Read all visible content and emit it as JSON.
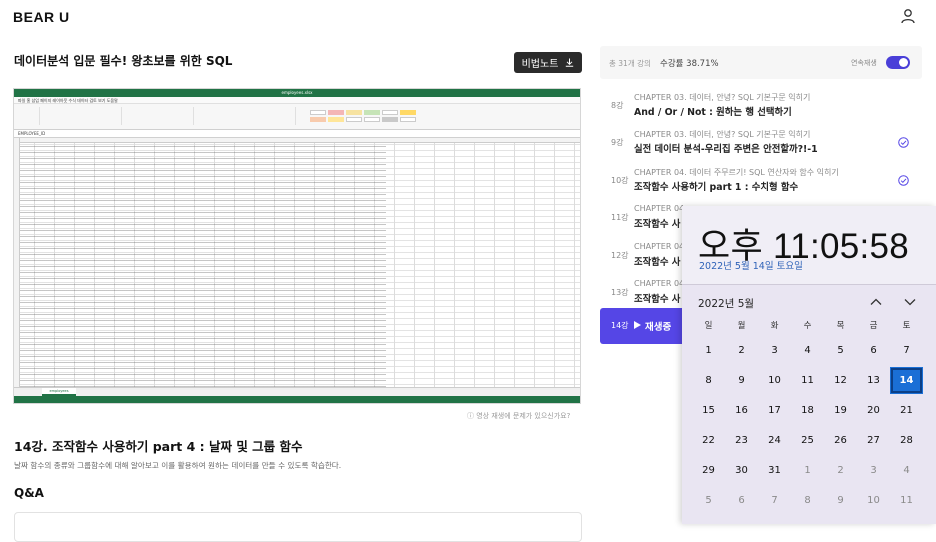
{
  "header": {
    "logo": "BEAR U"
  },
  "course": {
    "title": "데이터분석 입문 필수! 왕초보를 위한 SQL",
    "note_button": "비법노트"
  },
  "video": {
    "window_title": "employees.xlsx",
    "menu": "파일 홈 삽입 페이지 레이아웃 수식 데이터 검토 보기 도움말",
    "formula_bar": "EMPLOYEE_ID",
    "sheet_tab": "employees",
    "help_text": "ⓘ 영상 재생에 문제가 있으신가요?"
  },
  "lesson": {
    "title": "14강. 조작함수 사용하기 part 4 : 날짜 및 그룹 함수",
    "description": "날짜 함수의 종류와 그룹함수에 대해 알아보고 이를 활용하여 원하는 데이터를 만들 수 있도록 학습한다."
  },
  "qa": {
    "title": "Q&A"
  },
  "sidebar": {
    "count": "총 31개 강의",
    "progress": "수강률 38.71%",
    "autoplay_label": "연속재생",
    "items": [
      {
        "num": "8강",
        "chapter": "CHAPTER 03. 데이터, 안녕? SQL 기본구문 익히기",
        "title": "And / Or / Not : 원하는 행 선택하기",
        "done": false
      },
      {
        "num": "9강",
        "chapter": "CHAPTER 03. 데이터, 안녕? SQL 기본구문 익히기",
        "title": "실전 데이터 분석-우리집 주변은 안전할까?!-1",
        "done": true
      },
      {
        "num": "10강",
        "chapter": "CHAPTER 04. 데이터 주무르기! SQL 연산자와 함수 익히기",
        "title": "조작함수 사용하기 part 1 : 수치형 함수",
        "done": true
      },
      {
        "num": "11강",
        "chapter": "CHAPTER 04",
        "title": "조작함수 사",
        "done": false
      },
      {
        "num": "12강",
        "chapter": "CHAPTER 04",
        "title": "조작함수 사",
        "done": false
      },
      {
        "num": "13강",
        "chapter": "CHAPTER 04",
        "title": "조작함수 사",
        "done": false
      }
    ],
    "playing": {
      "num": "14강",
      "label": "재생중"
    }
  },
  "clock": {
    "time": "오후 11:05:58",
    "date": "2022년 5월 14일 토요일",
    "month": "2022년 5월",
    "weekdays": [
      "일",
      "월",
      "화",
      "수",
      "목",
      "금",
      "토"
    ],
    "days": [
      "1",
      "2",
      "3",
      "4",
      "5",
      "6",
      "7",
      "8",
      "9",
      "10",
      "11",
      "12",
      "13",
      "14",
      "15",
      "16",
      "17",
      "18",
      "19",
      "20",
      "21",
      "22",
      "23",
      "24",
      "25",
      "26",
      "27",
      "28",
      "29",
      "30",
      "31",
      "1",
      "2",
      "3",
      "4",
      "5",
      "6",
      "7",
      "8",
      "9",
      "10",
      "11"
    ],
    "today": "14"
  },
  "colors": {
    "accent": "#5546e6",
    "excel_green": "#217346",
    "calendar_today": "#1a6fd6"
  }
}
